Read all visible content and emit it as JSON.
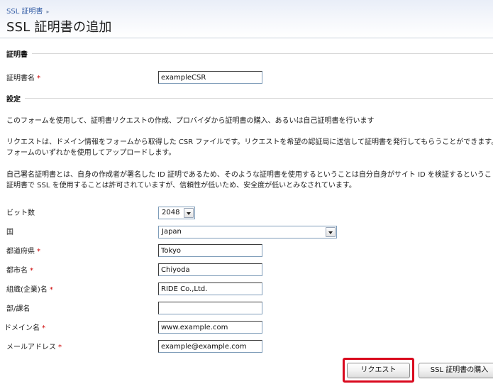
{
  "breadcrumb": {
    "link": "SSL 証明書",
    "sep_icon": "chevron-right-icon"
  },
  "page_title": "SSL 証明書の追加",
  "section_cert": {
    "title": "証明書",
    "name_label": "証明書名",
    "name_value": "exampleCSR"
  },
  "section_settings": {
    "title": "設定",
    "intro": "このフォームを使用して、証明書リクエストの作成、プロバイダから証明書の購入、あるいは自己証明書を行います",
    "request_p1": "リクエストは、ドメイン情報をフォームから取得した CSR ファイルです。リクエストを希望の認証局に送信して証明書を発行してもらうことができます。そ",
    "request_p2": "フォームのいずれかを使用してアップロードします。",
    "selfsigned_p1": "自己署名証明書とは、自身の作成者が署名した ID 証明であるため、そのような証明書を使用するということは自分自身がサイト ID を検証するというこ",
    "selfsigned_p2": "証明書で SSL を使用することは許可されていますが、信頼性が低いため、安全度が低いとみなされています。"
  },
  "form": {
    "required_mark": "*",
    "bits": {
      "label": "ビット数",
      "value": "2048"
    },
    "country": {
      "label": "国",
      "value": "Japan"
    },
    "state": {
      "label": "都道府県",
      "value": "Tokyo"
    },
    "city": {
      "label": "都市名",
      "value": "Chiyoda"
    },
    "org": {
      "label": "組織(企業)名",
      "value": "RIDE Co.,Ltd."
    },
    "dept": {
      "label": "部/課名",
      "value": ""
    },
    "domain": {
      "label": "ドメイン名",
      "value": "www.example.com"
    },
    "email": {
      "label": "メールアドレス",
      "value": "example@example.com"
    }
  },
  "buttons": {
    "request": "リクエスト",
    "buy": "SSL 証明書の購入"
  },
  "colors": {
    "required": "#cc0000",
    "highlight": "#d9091e",
    "link": "#3a62a8"
  }
}
